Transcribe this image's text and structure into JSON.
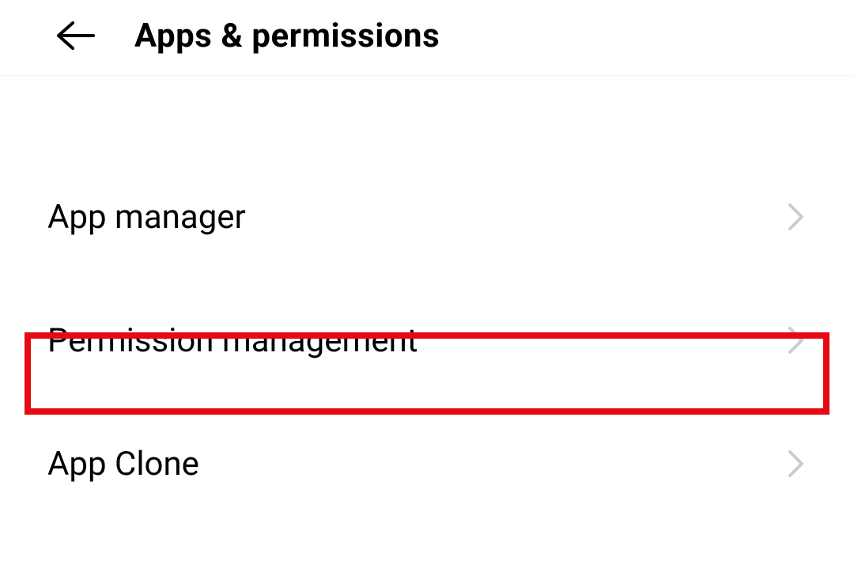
{
  "header": {
    "title": "Apps & permissions"
  },
  "items": [
    {
      "label": "App manager",
      "highlighted": true
    },
    {
      "label": "Permission management",
      "highlighted": false
    },
    {
      "label": "App Clone",
      "highlighted": false
    }
  ]
}
